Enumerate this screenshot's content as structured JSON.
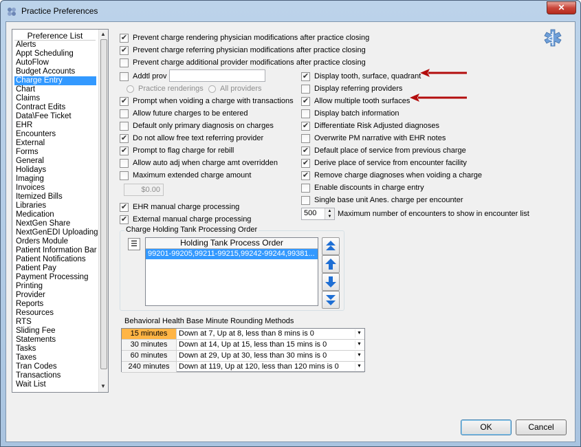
{
  "window": {
    "title": "Practice Preferences",
    "close_glyph": "✕"
  },
  "pref_list": {
    "header": "Preference List",
    "selected": "Charge Entry",
    "items": [
      "Alerts",
      "Appt Scheduling",
      "AutoFlow",
      "Budget Accounts",
      "Charge Entry",
      "Chart",
      "Claims",
      "Contract Edits",
      "Data\\Fee Ticket",
      "EHR",
      "Encounters",
      "External",
      "Forms",
      "General",
      "Holidays",
      "Imaging",
      "Invoices",
      "Itemized Bills",
      "Libraries",
      "Medication",
      "NextGen Share",
      "NextGenEDI Uploading",
      "Orders Module",
      "Patient Information Bar",
      "Patient Notifications",
      "Patient Pay",
      "Payment Processing",
      "Printing",
      "Provider",
      "Reports",
      "Resources",
      "RTS",
      "Sliding Fee",
      "Statements",
      "Tasks",
      "Taxes",
      "Tran Codes",
      "Transactions",
      "Wait List"
    ]
  },
  "top_options": [
    {
      "label": "Prevent charge rendering physician modifications after practice closing",
      "checked": true
    },
    {
      "label": "Prevent charge referring physician modifications after practice closing",
      "checked": true
    },
    {
      "label": "Prevent charge additional provider modifications after practice closing",
      "checked": false
    }
  ],
  "left_options": {
    "addtl_prov": {
      "label": "Addtl prov",
      "checked": false,
      "value": ""
    },
    "radio_practice": "Practice renderings",
    "radio_all": "All providers",
    "items": [
      {
        "label": "Prompt when voiding a charge with transactions",
        "checked": true
      },
      {
        "label": "Allow future charges to be entered",
        "checked": false
      },
      {
        "label": "Default only primary diagnosis on charges",
        "checked": false
      },
      {
        "label": "Do not allow free text referring provider",
        "checked": true
      },
      {
        "label": "Prompt to flag charge for rebill",
        "checked": true
      },
      {
        "label": "Allow auto adj when charge amt overridden",
        "checked": false
      },
      {
        "label": "Maximum extended charge amount",
        "checked": false
      }
    ],
    "max_amount": "$0.00",
    "ehr_manual": {
      "label": "EHR manual charge processing",
      "checked": true
    },
    "external_manual": {
      "label": "External manual charge processing",
      "checked": true
    }
  },
  "right_options": {
    "items": [
      {
        "label": "Display tooth, surface, quadrant",
        "checked": true
      },
      {
        "label": "Display referring providers",
        "checked": false
      },
      {
        "label": "Allow multiple tooth surfaces",
        "checked": true
      },
      {
        "label": "Display batch information",
        "checked": false
      },
      {
        "label": "Differentiate Risk Adjusted diagnoses",
        "checked": true
      },
      {
        "label": "Overwrite PM narrative with EHR notes",
        "checked": false
      },
      {
        "label": "Default place of service from previous charge",
        "checked": true
      },
      {
        "label": "Derive place of service from encounter facility",
        "checked": true
      },
      {
        "label": "Remove charge diagnoses when voiding a charge",
        "checked": true
      },
      {
        "label": "Enable discounts in charge entry",
        "checked": false
      },
      {
        "label": "Single base unit Anes. charge per encounter",
        "checked": false
      }
    ],
    "max_encounters_value": "500",
    "max_encounters_label": "Maximum number of encounters to show in encounter list"
  },
  "holding_tank": {
    "title": "Charge Holding Tank Processing Order",
    "column": "Holding Tank Process Order",
    "rows": [
      "99201-99205,99211-99215,99242-99244,99381..."
    ]
  },
  "behavioral": {
    "title": "Behavioral Health Base Minute Rounding Methods",
    "rows": [
      {
        "minutes": "15 minutes",
        "method": "Down at 7, Up at 8, less than 8 mins is 0",
        "selected": true
      },
      {
        "minutes": "30 minutes",
        "method": "Down at 14, Up at 15, less than 15 mins is 0",
        "selected": false
      },
      {
        "minutes": "60 minutes",
        "method": "Down at 29, Up at 30, less than 30 mins is 0",
        "selected": false
      },
      {
        "minutes": "240 minutes",
        "method": "Down at 119, Up at 120, less than 120 mins is 0",
        "selected": false
      }
    ]
  },
  "buttons": {
    "ok": "OK",
    "cancel": "Cancel"
  },
  "colors": {
    "selection": "#3399ff",
    "annotation_arrow": "#b30d0d",
    "selected_minutes": "#ffb545"
  }
}
